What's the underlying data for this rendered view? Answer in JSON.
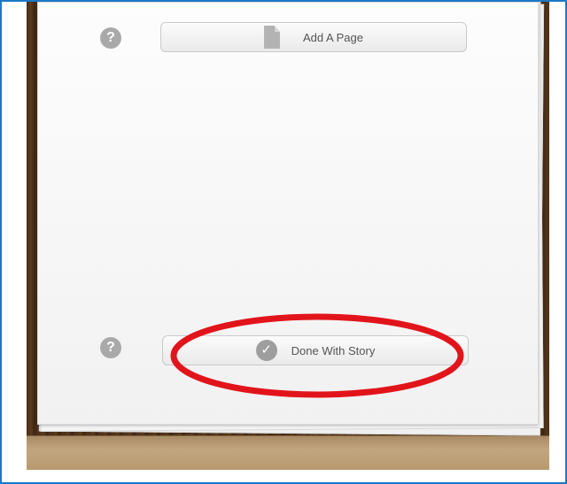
{
  "help_buttons": [
    {
      "label": "?"
    },
    {
      "label": "?"
    }
  ],
  "add_page_button": {
    "label": "Add A Page",
    "icon": "document-icon"
  },
  "done_button": {
    "label": "Done With Story",
    "icon": "checkmark-icon",
    "icon_glyph": "✓"
  },
  "annotation": {
    "color": "#e2141b",
    "shape": "ellipse"
  }
}
